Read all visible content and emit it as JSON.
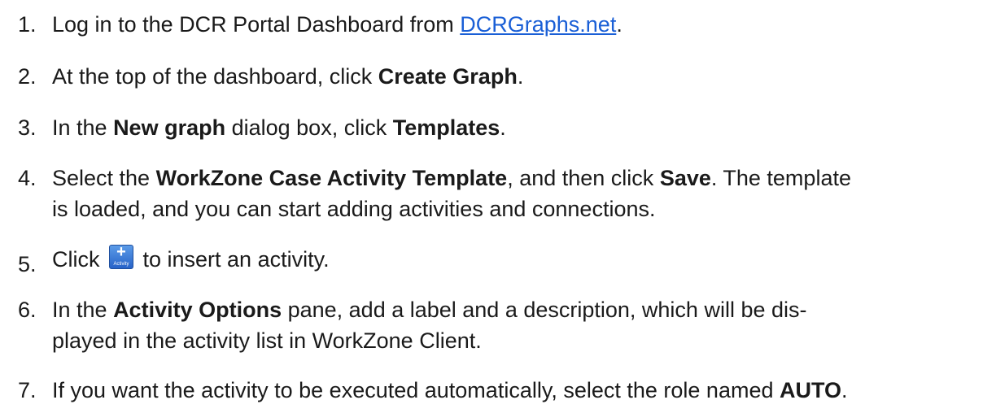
{
  "steps": [
    {
      "number": "1.",
      "parts": [
        "Log in to the DCR Portal Dashboard from ",
        "DCRGraphs.net",
        "."
      ]
    },
    {
      "number": "2.",
      "parts": [
        "At the top of the dashboard, click ",
        "Create Graph",
        "."
      ]
    },
    {
      "number": "3.",
      "parts": [
        "In the ",
        "New graph",
        " dialog box, click ",
        "Templates",
        "."
      ]
    },
    {
      "number": "4.",
      "parts": [
        "Select the ",
        "WorkZone Case Activity Template",
        ", and then click ",
        "Save",
        ". The template",
        "is loaded, and you can start adding activities and connections."
      ]
    },
    {
      "number": "5.",
      "parts": [
        "Click ",
        " to insert an activity."
      ],
      "icon": {
        "name": "add-activity-icon",
        "label": "Activity",
        "symbol": "+"
      }
    },
    {
      "number": "6.",
      "parts": [
        "In the ",
        "Activity Options",
        " pane, add a label and a description, which will be dis-",
        "played in the activity list in WorkZone Client."
      ]
    },
    {
      "number": "7.",
      "parts": [
        "If you want the activity to be executed automatically, select the role named ",
        "AUTO",
        "."
      ]
    }
  ]
}
